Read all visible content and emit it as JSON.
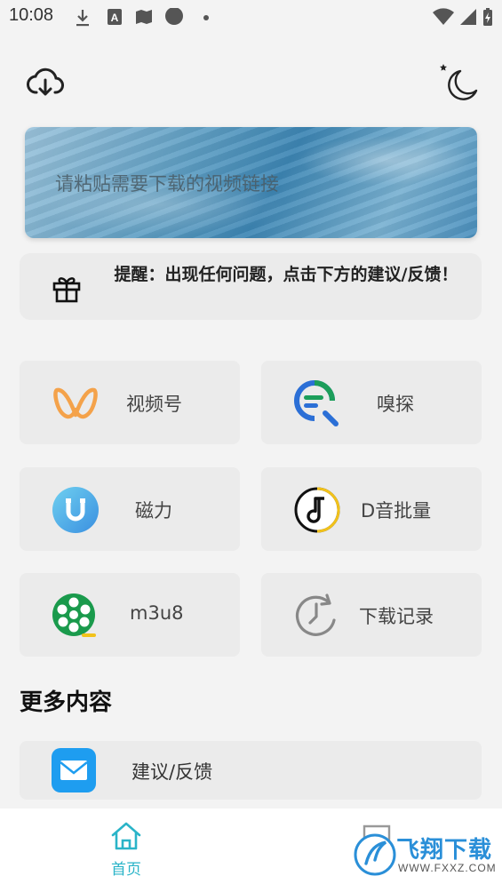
{
  "status_bar": {
    "time": "10:08"
  },
  "banner": {
    "input_placeholder": "请粘贴需要下载的视频链接"
  },
  "notice": {
    "text": "提醒：出现任何问题，点击下方的建议/反馈！"
  },
  "tiles": [
    {
      "label": "视频号",
      "icon": "butterfly-icon"
    },
    {
      "label": "嗅探",
      "icon": "sniff-search-icon"
    },
    {
      "label": "磁力",
      "icon": "magnet-icon"
    },
    {
      "label": "D音批量",
      "icon": "music-note-icon"
    },
    {
      "label": "m3u8",
      "icon": "film-reel-icon"
    },
    {
      "label": "下载记录",
      "icon": "history-clock-icon"
    }
  ],
  "more": {
    "title": "更多内容",
    "feedback_label": "建议/反馈"
  },
  "nav": {
    "home_label": "首页"
  },
  "watermark": {
    "text": "飞翔下载",
    "url": "WWW.FXXZ.COM"
  },
  "colors": {
    "accent": "#2ab4c8",
    "mail_blue": "#1e9df0",
    "butterfly_orange": "#f4a24a",
    "film_green": "#1a9a4c"
  }
}
